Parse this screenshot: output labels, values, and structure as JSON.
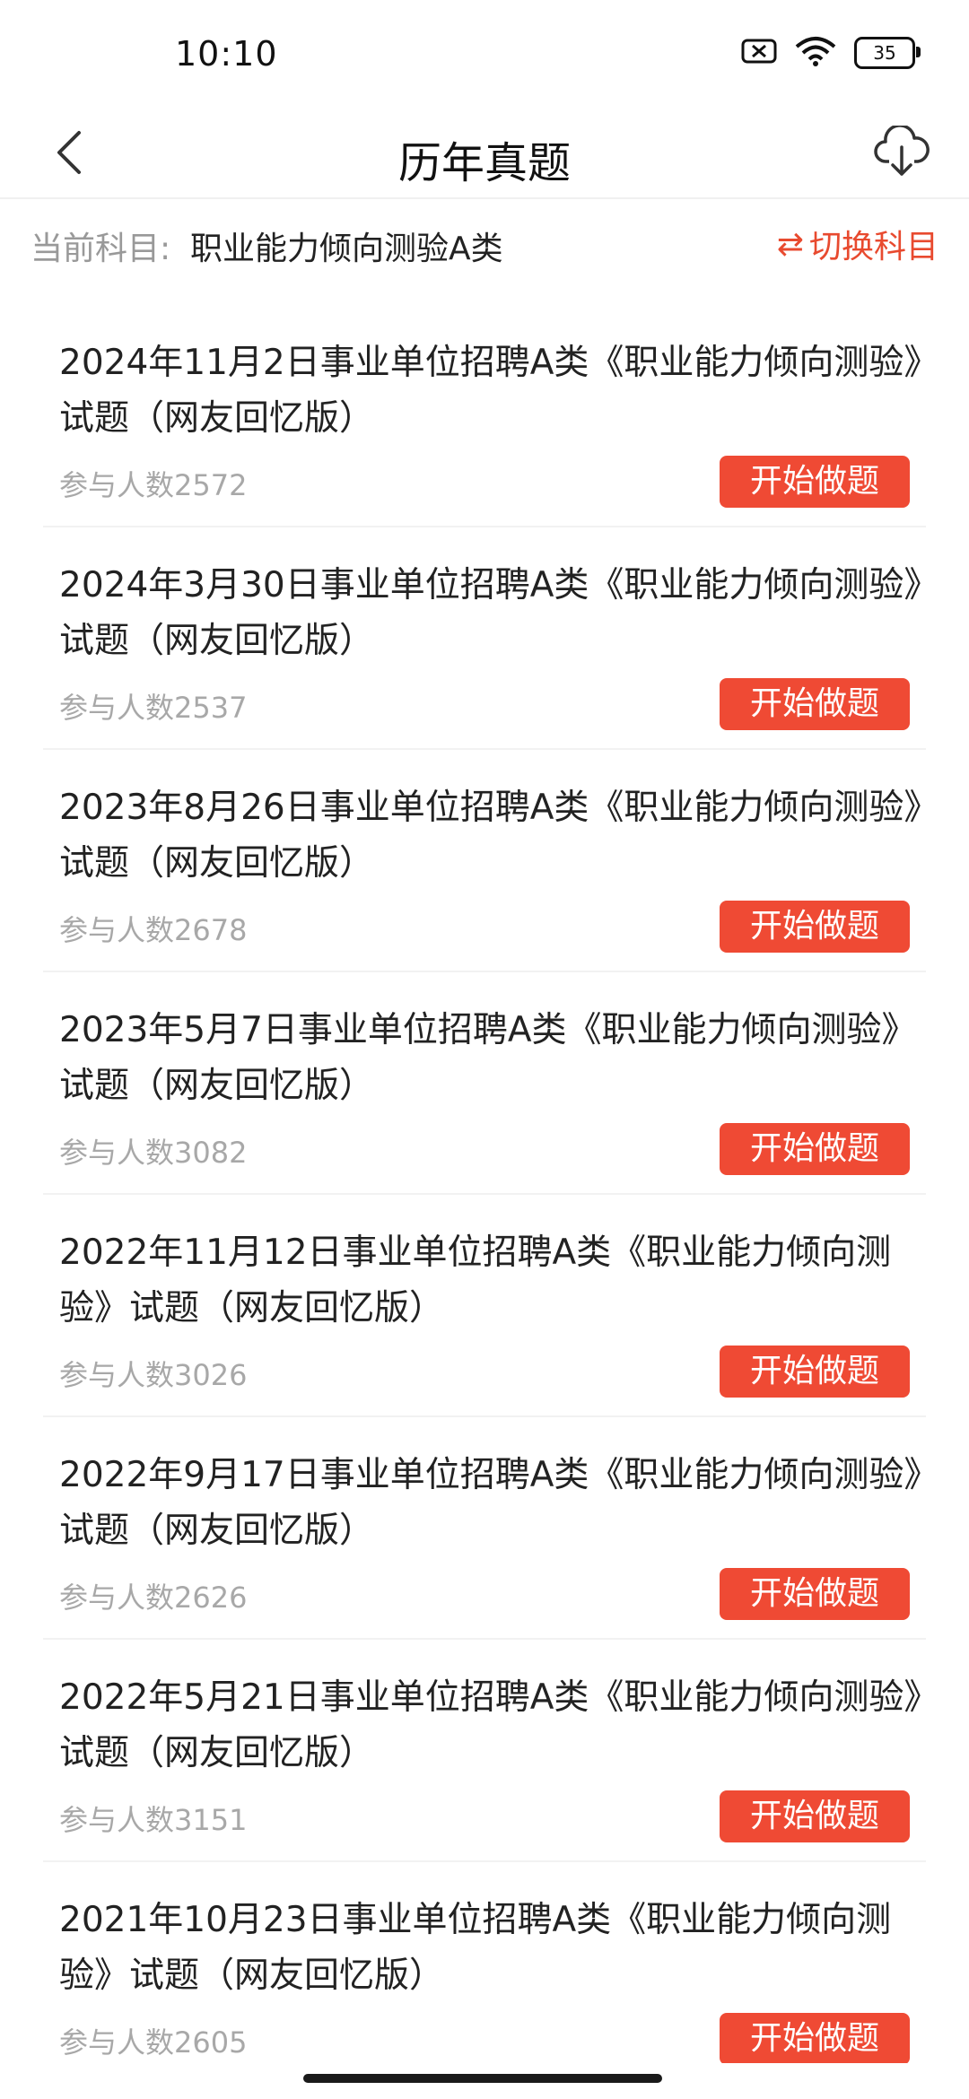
{
  "status": {
    "time": "10:10",
    "battery": "35"
  },
  "header": {
    "title": "历年真题"
  },
  "subject": {
    "label": "当前科目:",
    "value": "职业能力倾向测验A类",
    "switch_label": "切换科目",
    "switch_icon": "⇄"
  },
  "items": [
    {
      "title": "2024年11月2日事业单位招聘A类《职业能力倾向测验》试题（网友回忆版）",
      "count": "参与人数2572",
      "button": "开始做题"
    },
    {
      "title": "2024年3月30日事业单位招聘A类《职业能力倾向测验》试题（网友回忆版）",
      "count": "参与人数2537",
      "button": "开始做题"
    },
    {
      "title": "2023年8月26日事业单位招聘A类《职业能力倾向测验》试题（网友回忆版）",
      "count": "参与人数2678",
      "button": "开始做题"
    },
    {
      "title": "2023年5月7日事业单位招聘A类《职业能力倾向测验》试题（网友回忆版）",
      "count": "参与人数3082",
      "button": "开始做题"
    },
    {
      "title": "2022年11月12日事业单位招聘A类《职业能力倾向测验》试题（网友回忆版）",
      "count": "参与人数3026",
      "button": "开始做题"
    },
    {
      "title": "2022年9月17日事业单位招聘A类《职业能力倾向测验》试题（网友回忆版）",
      "count": "参与人数2626",
      "button": "开始做题"
    },
    {
      "title": "2022年5月21日事业单位招聘A类《职业能力倾向测验》试题（网友回忆版）",
      "count": "参与人数3151",
      "button": "开始做题"
    },
    {
      "title": "2021年10月23日事业单位招聘A类《职业能力倾向测验》试题（网友回忆版）",
      "count": "参与人数2605",
      "button": "开始做题"
    }
  ]
}
